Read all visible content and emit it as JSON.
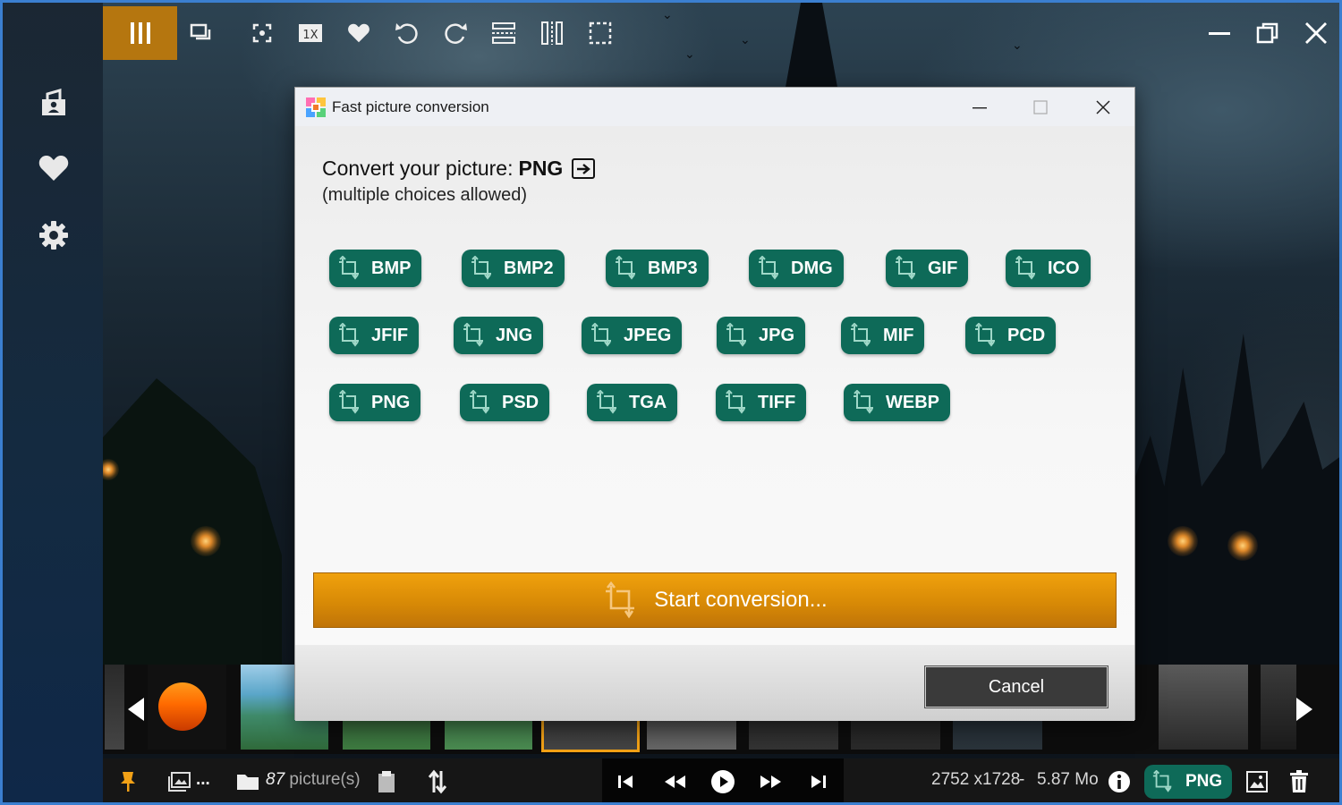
{
  "dialog": {
    "title": "Fast picture conversion",
    "heading": "Convert your picture:",
    "current_format": "PNG",
    "subheading": "(multiple choices allowed)",
    "formats": [
      "BMP",
      "BMP2",
      "BMP3",
      "DMG",
      "GIF",
      "ICO",
      "JFIF",
      "JNG",
      "JPEG",
      "JPG",
      "MIF",
      "PCD",
      "PNG",
      "PSD",
      "TGA",
      "TIFF",
      "WEBP"
    ],
    "start_label": "Start conversion...",
    "cancel_label": "Cancel"
  },
  "bottombar": {
    "ellipsis": "...",
    "picture_count": "87",
    "picture_suffix": " picture(s)",
    "dimensions": "2752 x1728",
    "separator": "-",
    "filesize": "5.87 Mo",
    "format_badge": "PNG"
  },
  "colors": {
    "accent_orange": "#b5760f",
    "format_green": "#0e6a58",
    "start_button": "#e39608"
  },
  "icons": {
    "toolbar": [
      "menu-icon",
      "slideshow-icon",
      "fullscreen-icon",
      "zoom-1x-icon",
      "heart-icon",
      "rotate-left-icon",
      "rotate-right-icon",
      "flip-vertical-icon",
      "flip-horizontal-icon",
      "crop-icon"
    ],
    "window": [
      "minimize-icon",
      "restore-icon",
      "close-icon"
    ],
    "sidebar": [
      "profile-icon",
      "heart-icon",
      "gear-icon"
    ]
  }
}
